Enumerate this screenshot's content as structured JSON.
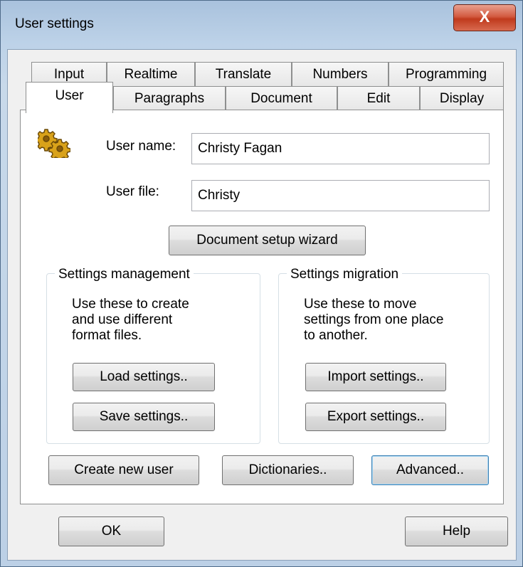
{
  "window": {
    "title": "User settings",
    "close_glyph": "X"
  },
  "tabs_row1": [
    "Input",
    "Realtime",
    "Translate",
    "Numbers",
    "Programming"
  ],
  "tabs_row2": [
    "User",
    "Paragraphs",
    "Document",
    "Edit",
    "Display"
  ],
  "active_tab": "User",
  "user": {
    "icon": "gear-user-icon",
    "name_label": "User name:",
    "name_value": "Christy Fagan",
    "file_label": "User file:",
    "file_value": "Christy",
    "wizard_button": "Document setup wizard"
  },
  "settings_management": {
    "title": "Settings management",
    "desc_lines": [
      "Use these to create",
      "and use different",
      "format files."
    ],
    "load_button": "Load settings..",
    "save_button": "Save settings.."
  },
  "settings_migration": {
    "title": "Settings migration",
    "desc_lines": [
      "Use these to move",
      "settings from one place",
      "to another."
    ],
    "import_button": "Import settings..",
    "export_button": "Export settings.."
  },
  "bottom_buttons": {
    "create_user": "Create new user",
    "dictionaries": "Dictionaries..",
    "advanced": "Advanced.."
  },
  "dialog_buttons": {
    "ok": "OK",
    "help": "Help"
  }
}
